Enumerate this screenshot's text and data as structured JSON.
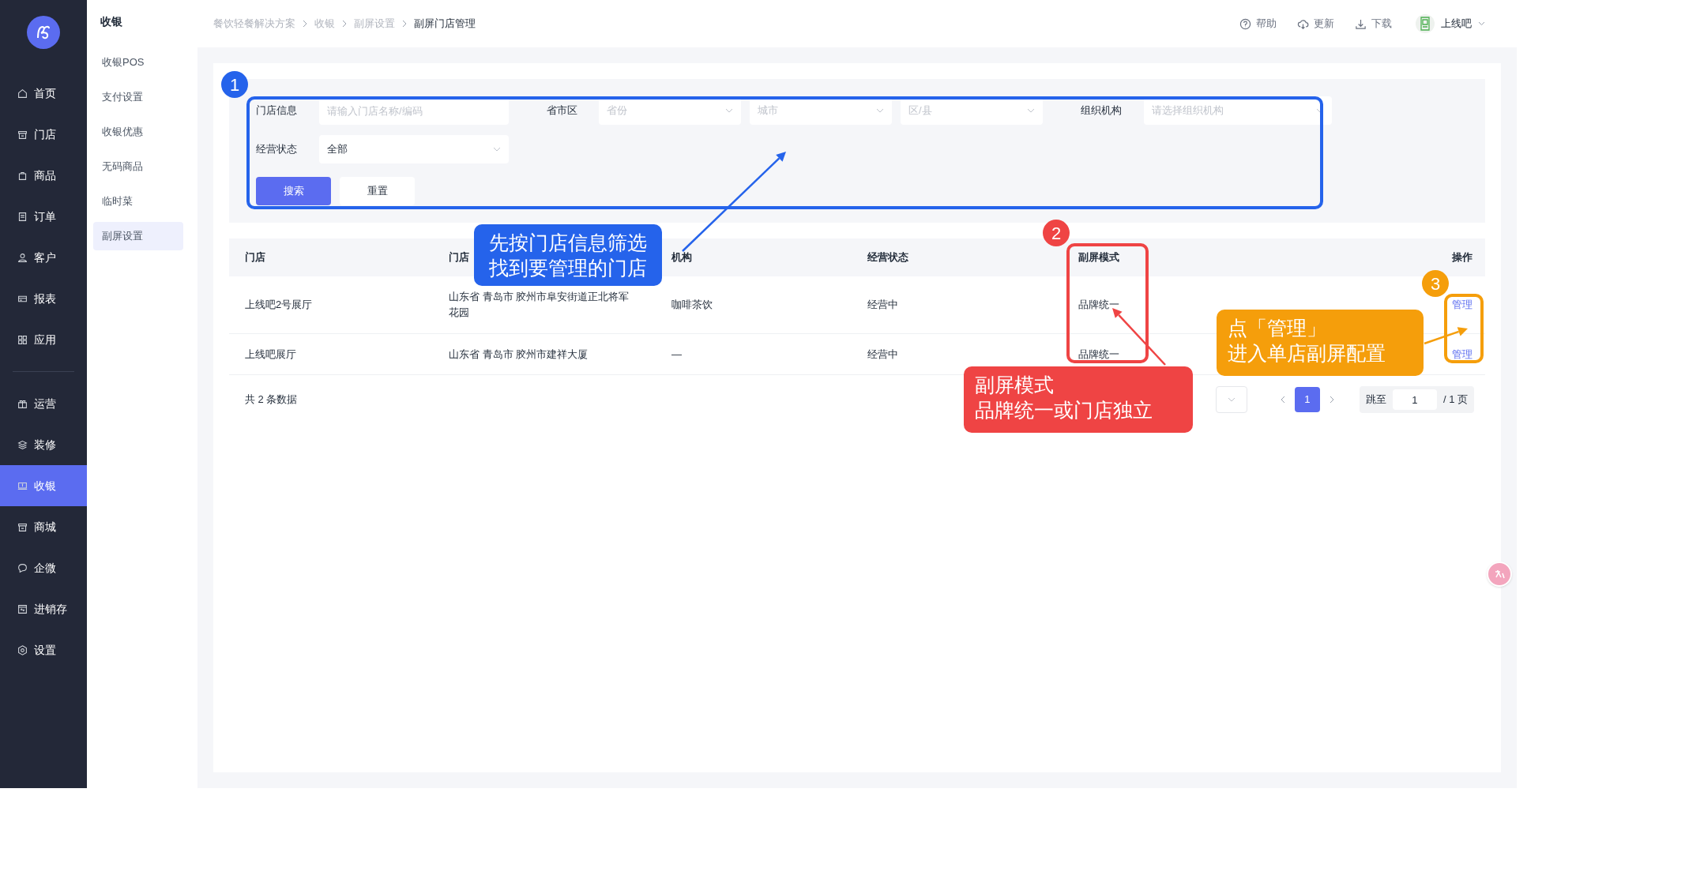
{
  "sidebar": {
    "groups": [
      {
        "items": [
          {
            "label": "首页",
            "selected": false
          },
          {
            "label": "门店",
            "selected": false
          },
          {
            "label": "商品",
            "selected": false
          },
          {
            "label": "订单",
            "selected": false
          },
          {
            "label": "客户",
            "selected": false
          },
          {
            "label": "报表",
            "selected": false
          },
          {
            "label": "应用",
            "selected": false
          }
        ]
      },
      {
        "items": [
          {
            "label": "运营",
            "selected": false
          },
          {
            "label": "装修",
            "selected": false
          },
          {
            "label": "收银",
            "selected": true
          },
          {
            "label": "商城",
            "selected": false
          },
          {
            "label": "企微",
            "selected": false
          },
          {
            "label": "进销存",
            "selected": false
          },
          {
            "label": "设置",
            "selected": false
          }
        ]
      }
    ]
  },
  "submenu": {
    "title": "收银",
    "items": [
      {
        "label": "收银POS",
        "selected": false
      },
      {
        "label": "支付设置",
        "selected": false
      },
      {
        "label": "收银优惠",
        "selected": false
      },
      {
        "label": "无码商品",
        "selected": false
      },
      {
        "label": "临时菜",
        "selected": false
      },
      {
        "label": "副屏设置",
        "selected": true
      }
    ]
  },
  "breadcrumb": [
    "餐饮轻餐解决方案",
    "收银",
    "副屏设置",
    "副屏门店管理"
  ],
  "header_actions": [
    "帮助",
    "更新",
    "下载"
  ],
  "user": {
    "name": "上线吧"
  },
  "filters": {
    "rows": [
      {
        "fields": [
          {
            "label": "门店信息",
            "kind": "input",
            "placeholder": "请输入门店名称/编码"
          },
          {
            "label": "省市区",
            "kind": "selects",
            "selects": [
              "省份",
              "城市",
              "区/县"
            ]
          },
          {
            "label": "组织机构",
            "kind": "select",
            "placeholder": "请选择组织机构"
          }
        ]
      },
      {
        "fields": [
          {
            "label": "经营状态",
            "kind": "select",
            "value": "全部"
          }
        ]
      }
    ],
    "buttons": [
      {
        "label": "搜索",
        "kind": "primary"
      },
      {
        "label": "重置",
        "kind": "default"
      }
    ]
  },
  "table": {
    "columns": [
      "门店",
      "门店",
      "机构",
      "经营状态",
      "副屏模式",
      "操作"
    ],
    "rows": [
      {
        "cells": [
          "上线吧2号展厅",
          "山东省 青岛市 胶州市阜安街道正北将军花园",
          "咖啡茶饮",
          "经营中",
          "品牌统一"
        ],
        "action": "管理"
      },
      {
        "cells": [
          "上线吧展厅",
          "山东省 青岛市 胶州市建祥大厦",
          "—",
          "经营中",
          "品牌统一"
        ],
        "action": "管理"
      }
    ]
  },
  "pagination": {
    "total": "共 2 条数据",
    "pages": [
      {
        "label": "1",
        "selected": true
      }
    ],
    "jump_label": "跳至",
    "jump_value": "1",
    "page_count": "/ 1 页"
  },
  "annotations": [
    {
      "number": "1",
      "color": "#2563eb",
      "lines": [
        "先按门店信息筛选",
        "找到要管理的门店"
      ]
    },
    {
      "number": "2",
      "color": "#ef4444",
      "lines": [
        "副屏模式",
        "品牌统一或门店独立"
      ]
    },
    {
      "number": "3",
      "color": "#f59e0b",
      "lines": [
        "点「管理」",
        "进入单店副屏配置"
      ]
    }
  ]
}
